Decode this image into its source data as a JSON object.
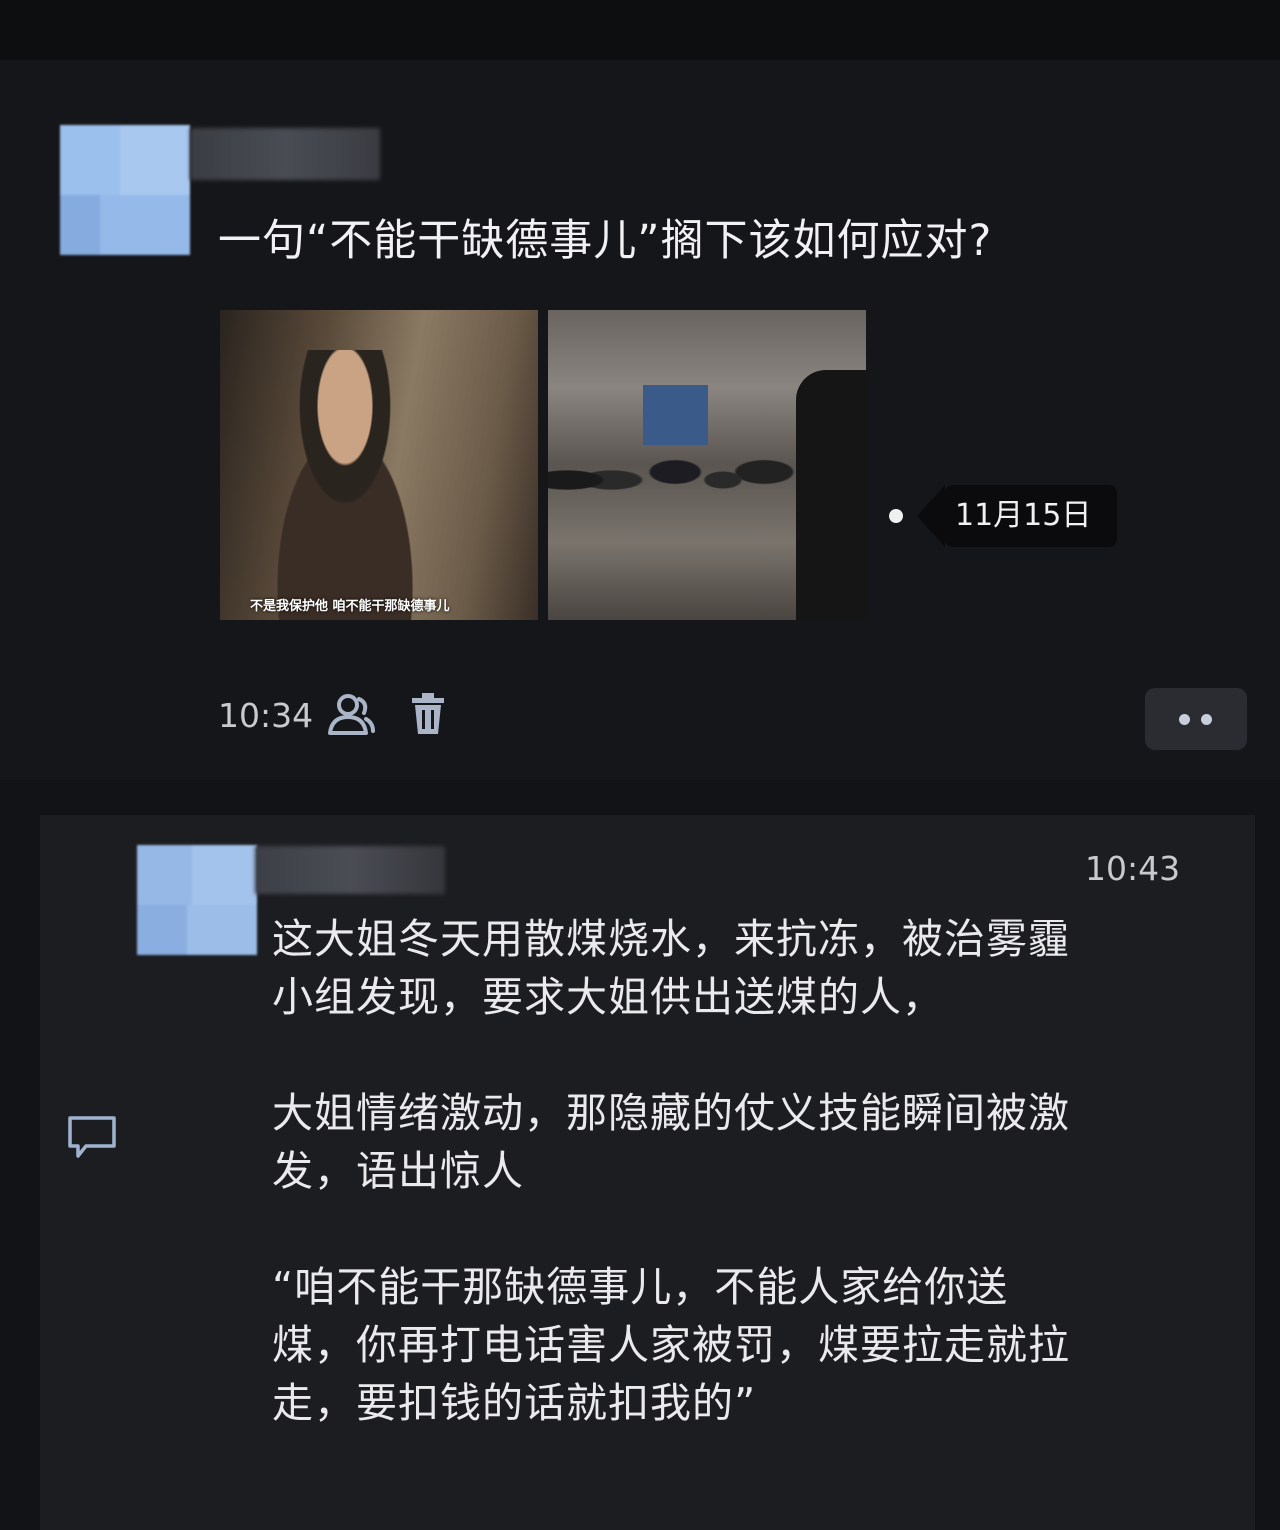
{
  "post": {
    "text": "一句“不能干缺德事儿”搁下该如何应对?",
    "image1_caption": "不是我保护他 咱不能干那缺德事儿",
    "date_tag": "11月15日",
    "time": "10:34",
    "icons": {
      "visibility": "friends-icon",
      "delete": "trash-icon",
      "more": "more-icon"
    }
  },
  "comment": {
    "time": "10:43",
    "paragraphs": [
      "这大姐冬天用散煤烧水，来抗冻，被治雾霾\n小组发现，要求大姐供出送煤的人，",
      "大姐情绪激动，那隐藏的仗义技能瞬间被激\n发，语出惊人",
      "“咱不能干那缺德事儿，不能人家给你送\n煤，你再打电话害人家被罚，煤要拉走就拉\n走，要扣钱的话就扣我的”"
    ],
    "icon": "comment-icon"
  },
  "colors": {
    "background": "#121316",
    "comment_bg": "#1c1d21",
    "text": "#e8e8ea",
    "button_bg": "#2a2c31"
  }
}
